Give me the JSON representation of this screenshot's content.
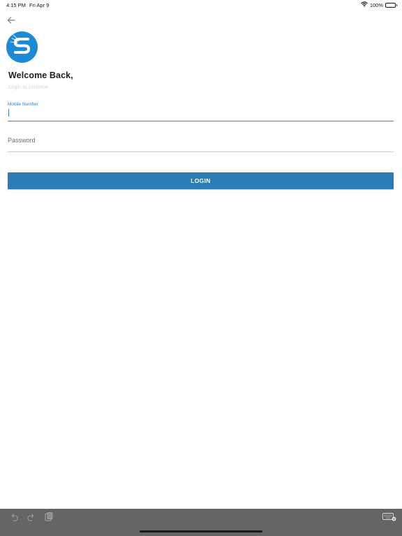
{
  "status_bar": {
    "time": "4:15 PM",
    "date": "Fri Apr 9",
    "battery": "100%",
    "battery_level": 1.0,
    "wifi_icon": "wifi-icon"
  },
  "nav": {
    "back_icon": "arrow-left-icon"
  },
  "header": {
    "logo_icon": "s-logo-icon",
    "title": "Welcome Back,",
    "subtitle": "Login to continue"
  },
  "form": {
    "mobile_label": "Mobile Number",
    "mobile_value": "",
    "password_placeholder": "Password",
    "login_label": "LOGIN"
  },
  "keyboard_toolbar": {
    "undo_icon": "undo-icon",
    "redo_icon": "redo-icon",
    "paste_icon": "clipboard-icon",
    "keyboard_icon": "keyboard-icon"
  },
  "colors": {
    "accent": "#2e86c9",
    "button": "#2b7db5",
    "logo": "#1c8ad6",
    "toolbar": "#656565"
  }
}
